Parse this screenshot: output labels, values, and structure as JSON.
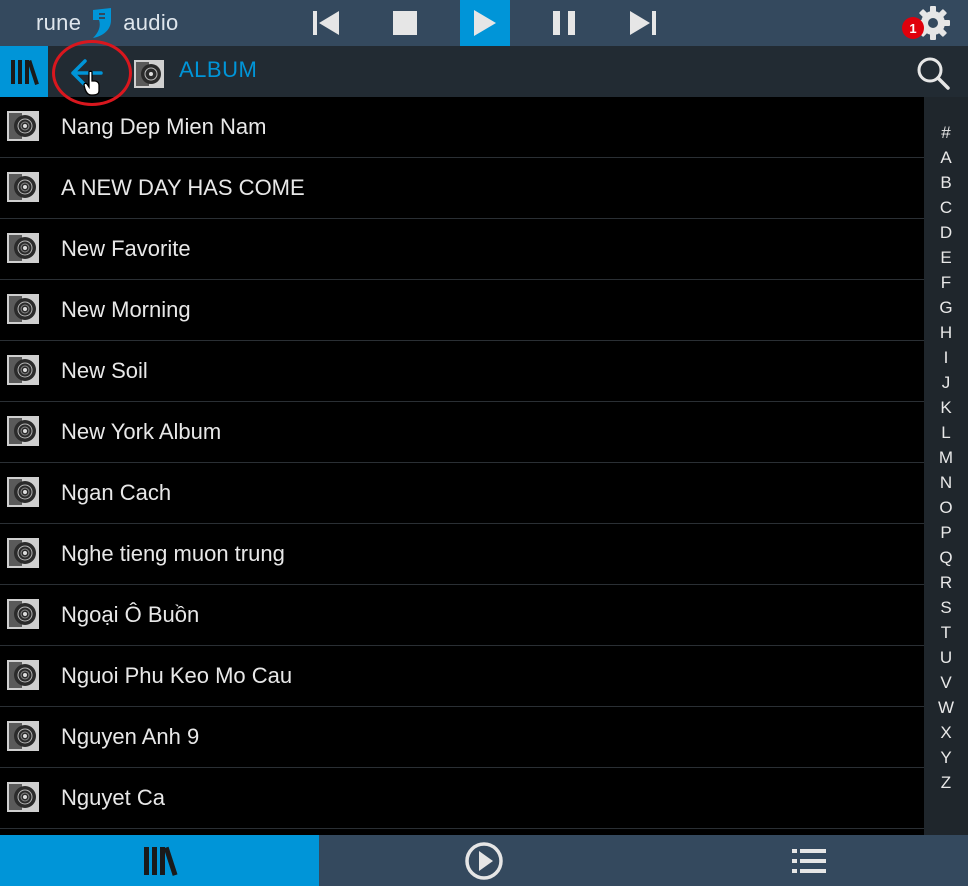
{
  "app": {
    "name_left": "rune",
    "name_right": "audio",
    "notification_count": "1"
  },
  "colors": {
    "accent": "#0095d8",
    "topbar": "#34495e",
    "subbar": "#222b33",
    "badge": "#e0000c",
    "ring": "#d9171e"
  },
  "icons": {
    "prev": "skip-previous-icon",
    "stop": "stop-icon",
    "play": "play-icon",
    "pause": "pause-icon",
    "next": "skip-next-icon",
    "settings": "gear-icon",
    "library": "library-icon",
    "back": "arrow-left-icon",
    "album": "album-icon",
    "search": "search-icon",
    "playlist": "list-icon"
  },
  "breadcrumb": {
    "label": "ALBUM"
  },
  "albums": [
    "Nang Dep Mien Nam",
    "A NEW DAY HAS COME",
    "New Favorite",
    "New Morning",
    "New Soil",
    "New York Album",
    "Ngan Cach",
    "Nghe tieng muon trung",
    "Ngoại Ô Buồn",
    "Nguoi Phu Keo Mo Cau",
    "Nguyen Anh 9",
    "Nguyet Ca"
  ],
  "index_letters": [
    "#",
    "A",
    "B",
    "C",
    "D",
    "E",
    "F",
    "G",
    "H",
    "I",
    "J",
    "K",
    "L",
    "M",
    "N",
    "O",
    "P",
    "Q",
    "R",
    "S",
    "T",
    "U",
    "V",
    "W",
    "X",
    "Y",
    "Z"
  ]
}
